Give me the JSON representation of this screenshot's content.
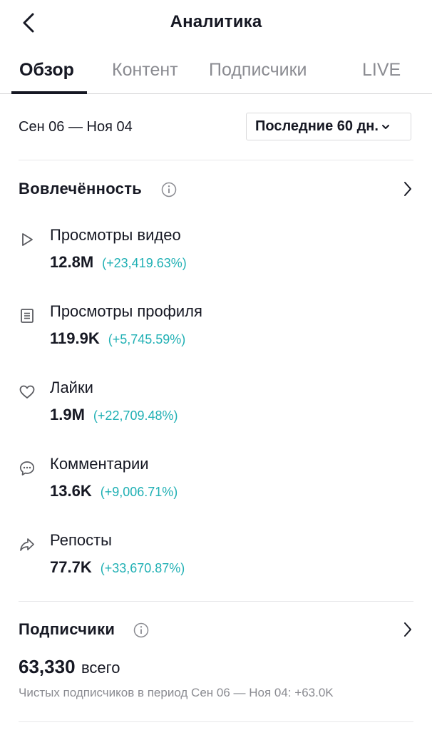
{
  "header": {
    "title": "Аналитика",
    "back_icon": "chevron-left-icon"
  },
  "tabs": [
    {
      "label": "Обзор",
      "active": true
    },
    {
      "label": "Контент",
      "active": false
    },
    {
      "label": "Подписчики",
      "active": false
    },
    {
      "label": "LIVE",
      "active": false
    }
  ],
  "date_range": "Сен 06 — Ноя 04",
  "period_select": {
    "value": "Последние 60 дн."
  },
  "engagement": {
    "title": "Вовлечённость",
    "metrics": [
      {
        "icon": "play-icon",
        "label": "Просмотры видео",
        "value": "12.8M",
        "change": "(+23,419.63%)"
      },
      {
        "icon": "profile-doc-icon",
        "label": "Просмотры профиля",
        "value": "119.9K",
        "change": "(+5,745.59%)"
      },
      {
        "icon": "heart-icon",
        "label": "Лайки",
        "value": "1.9M",
        "change": "(+22,709.48%)"
      },
      {
        "icon": "comment-icon",
        "label": "Комментарии",
        "value": "13.6K",
        "change": "(+9,006.71%)"
      },
      {
        "icon": "share-icon",
        "label": "Репосты",
        "value": "77.7K",
        "change": "(+33,670.87%)"
      }
    ]
  },
  "followers": {
    "title": "Подписчики",
    "total": "63,330",
    "total_word": "всего",
    "net_text": "Чистых подписчиков в период Сен 06 — Ноя 04: +63.0K"
  },
  "colors": {
    "accent_change": "#20b0b4",
    "text": "#161823",
    "muted": "#8a8b91"
  }
}
